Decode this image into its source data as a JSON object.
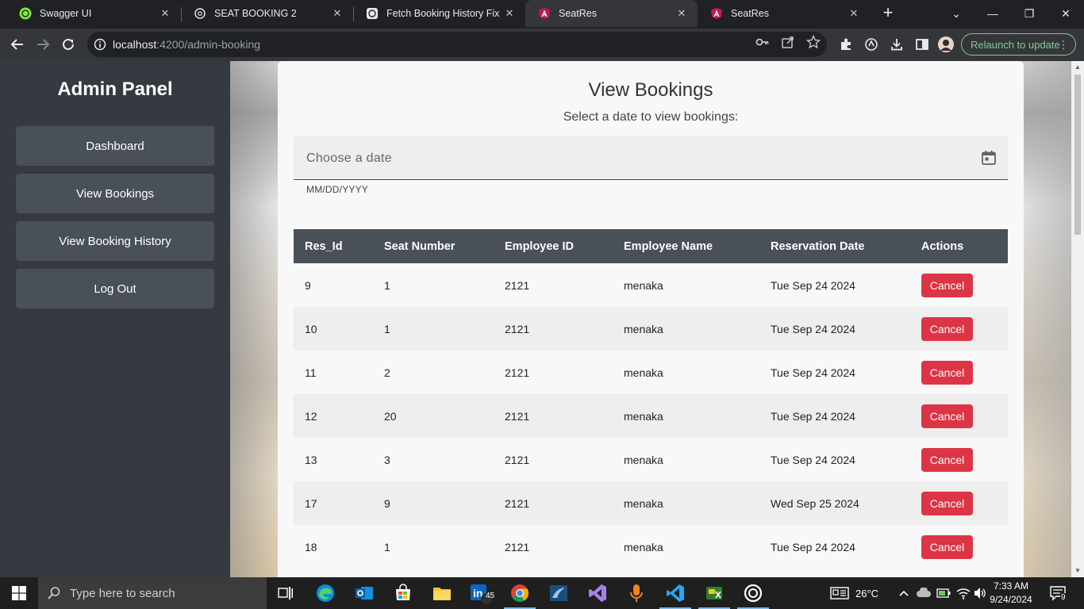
{
  "browser": {
    "tabs": [
      {
        "title": "Swagger UI"
      },
      {
        "title": "SEAT BOOKING 2"
      },
      {
        "title": "Fetch Booking History Fix"
      },
      {
        "title": "SeatRes"
      },
      {
        "title": "SeatRes"
      }
    ],
    "url_host": "localhost",
    "url_path": ":4200/admin-booking",
    "relaunch_label": "Relaunch to update"
  },
  "sidebar": {
    "title": "Admin Panel",
    "items": [
      {
        "label": "Dashboard"
      },
      {
        "label": "View Bookings"
      },
      {
        "label": "View Booking History"
      },
      {
        "label": "Log Out"
      }
    ]
  },
  "main": {
    "title": "View Bookings",
    "subtitle": "Select a date to view bookings:",
    "date_placeholder": "Choose a date",
    "date_hint": "MM/DD/YYYY",
    "columns": [
      "Res_Id",
      "Seat Number",
      "Employee ID",
      "Employee Name",
      "Reservation Date",
      "Actions"
    ],
    "cancel_label": "Cancel",
    "rows": [
      {
        "res_id": "9",
        "seat": "1",
        "emp_id": "2121",
        "name": "menaka",
        "date": "Tue Sep 24 2024"
      },
      {
        "res_id": "10",
        "seat": "1",
        "emp_id": "2121",
        "name": "menaka",
        "date": "Tue Sep 24 2024"
      },
      {
        "res_id": "11",
        "seat": "2",
        "emp_id": "2121",
        "name": "menaka",
        "date": "Tue Sep 24 2024"
      },
      {
        "res_id": "12",
        "seat": "20",
        "emp_id": "2121",
        "name": "menaka",
        "date": "Tue Sep 24 2024"
      },
      {
        "res_id": "13",
        "seat": "3",
        "emp_id": "2121",
        "name": "menaka",
        "date": "Tue Sep 24 2024"
      },
      {
        "res_id": "17",
        "seat": "9",
        "emp_id": "2121",
        "name": "menaka",
        "date": "Wed Sep 25 2024"
      },
      {
        "res_id": "18",
        "seat": "1",
        "emp_id": "2121",
        "name": "menaka",
        "date": "Tue Sep 24 2024"
      }
    ]
  },
  "taskbar": {
    "search_placeholder": "Type here to search",
    "linkedin_badge": "45",
    "weather": "26°C",
    "time": "7:33 AM",
    "date": "9/24/2024",
    "notification_count": "9"
  },
  "colors": {
    "sidebar_bg": "#343a40",
    "sidebar_button": "#495057",
    "table_header": "#495057",
    "cancel_button": "#dc3545",
    "relaunch_green": "#81c995"
  }
}
